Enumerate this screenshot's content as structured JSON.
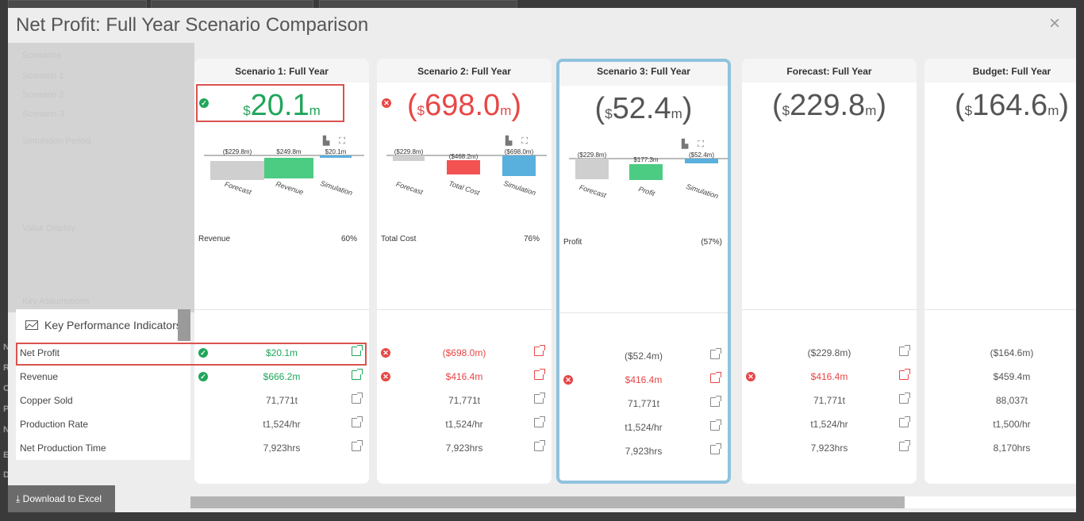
{
  "background": {
    "left_letters": [
      "N",
      "R",
      "C",
      "P",
      "N",
      "E",
      "Deplo"
    ],
    "side_items": [
      "Scenarios",
      "Scenario 1",
      "Scenario 2",
      "Scenario 3",
      "Simulation Period",
      "Value Display",
      "Key Assumptions"
    ]
  },
  "modal": {
    "title": "Net Profit: Full Year Scenario Comparison",
    "close_label": "×",
    "download_label": "Download to Excel"
  },
  "kpi": {
    "header": "Key Performance Indicators",
    "labels": [
      "Net Profit",
      "Revenue",
      "Copper Sold",
      "Production Rate",
      "Net Production Time"
    ]
  },
  "scenarios": [
    {
      "title": "Scenario 1: Full Year",
      "big_value": {
        "prefix": "$",
        "number": "20.1",
        "suffix": "m",
        "negative": false,
        "color": "green"
      },
      "status": "ok",
      "has_chart": true,
      "chart_labels": {
        "top": [
          "($229.8m)",
          "$249.8m",
          "$20.1m"
        ],
        "bottom": [
          "Forecast",
          "Revenue",
          "Simulation"
        ]
      },
      "metric": {
        "name": "Revenue",
        "value": "60%"
      },
      "kpis": [
        {
          "value": "$20.1m",
          "status": "ok",
          "color": "green"
        },
        {
          "value": "$666.2m",
          "status": "ok",
          "color": "green"
        },
        {
          "value": "71,771t",
          "status": "",
          "color": ""
        },
        {
          "value": "t1,524/hr",
          "status": "",
          "color": ""
        },
        {
          "value": "7,923hrs",
          "status": "",
          "color": ""
        }
      ]
    },
    {
      "title": "Scenario 2: Full Year",
      "big_value": {
        "prefix": "$",
        "number": "698.0",
        "suffix": "m",
        "negative": true,
        "color": "red"
      },
      "status": "bad",
      "has_chart": true,
      "chart_labels": {
        "top": [
          "($229.8m)",
          "($468.2m)",
          "($698.0m)"
        ],
        "bottom": [
          "Forecast",
          "Total Cost",
          "Simulation"
        ]
      },
      "metric": {
        "name": "Total Cost",
        "value": "76%"
      },
      "kpis": [
        {
          "value": "($698.0m)",
          "status": "bad",
          "color": "red"
        },
        {
          "value": "$416.4m",
          "status": "bad",
          "color": "red"
        },
        {
          "value": "71,771t",
          "status": "",
          "color": ""
        },
        {
          "value": "t1,524/hr",
          "status": "",
          "color": ""
        },
        {
          "value": "7,923hrs",
          "status": "",
          "color": ""
        }
      ]
    },
    {
      "title": "Scenario 3: Full Year",
      "big_value": {
        "prefix": "$",
        "number": "52.4",
        "suffix": "m",
        "negative": true,
        "color": "gray"
      },
      "status": "",
      "has_chart": true,
      "chart_labels": {
        "top": [
          "($229.8m)",
          "$177.3m",
          "($52.4m)"
        ],
        "bottom": [
          "Forecast",
          "Profit",
          "Simulation"
        ]
      },
      "metric": {
        "name": "Profit",
        "value": "(57%)"
      },
      "kpis": [
        {
          "value": "($52.4m)",
          "status": "",
          "color": ""
        },
        {
          "value": "$416.4m",
          "status": "bad",
          "color": "red"
        },
        {
          "value": "71,771t",
          "status": "",
          "color": ""
        },
        {
          "value": "t1,524/hr",
          "status": "",
          "color": ""
        },
        {
          "value": "7,923hrs",
          "status": "",
          "color": ""
        }
      ]
    },
    {
      "title": "Forecast: Full Year",
      "big_value": {
        "prefix": "$",
        "number": "229.8",
        "suffix": "m",
        "negative": true,
        "color": "gray"
      },
      "status": "",
      "has_chart": false,
      "kpis": [
        {
          "value": "($229.8m)",
          "status": "",
          "color": ""
        },
        {
          "value": "$416.4m",
          "status": "bad",
          "color": "red"
        },
        {
          "value": "71,771t",
          "status": "",
          "color": ""
        },
        {
          "value": "t1,524/hr",
          "status": "",
          "color": ""
        },
        {
          "value": "7,923hrs",
          "status": "",
          "color": ""
        }
      ]
    },
    {
      "title": "Budget: Full Year",
      "big_value": {
        "prefix": "$",
        "number": "164.6",
        "suffix": "m",
        "negative": true,
        "color": "gray"
      },
      "status": "",
      "has_chart": false,
      "kpis": [
        {
          "value": "($164.6m)",
          "status": "",
          "color": ""
        },
        {
          "value": "$459.4m",
          "status": "",
          "color": ""
        },
        {
          "value": "88,037t",
          "status": "",
          "color": ""
        },
        {
          "value": "t1,500/hr",
          "status": "",
          "color": ""
        },
        {
          "value": "8,170hrs",
          "status": "",
          "color": ""
        }
      ]
    }
  ],
  "colors": {
    "green": "#21a55a",
    "red": "#e74646",
    "selected_border": "#8fc3dd",
    "bar_gray": "#cfcfcf",
    "bar_green": "#4ccb83",
    "bar_red": "#f25252",
    "bar_blue": "#5ab0dc"
  }
}
